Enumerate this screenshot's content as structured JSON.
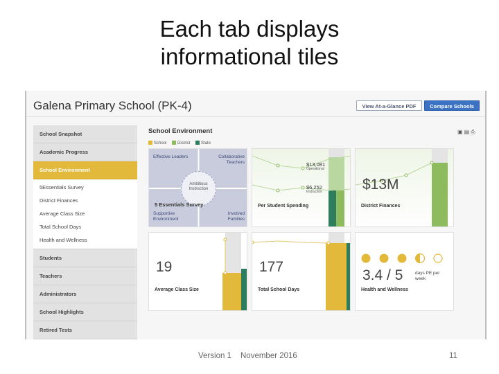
{
  "slide": {
    "title_line1": "Each tab displays",
    "title_line2": "informational tiles",
    "footer_version": "Version 1",
    "footer_date": "November 2016",
    "page_number": "11"
  },
  "header": {
    "school_name": "Galena Primary School (PK-4)",
    "at_a_glance_label": "View At-a-Glance PDF",
    "compare_label": "Compare Schools"
  },
  "sidebar": {
    "top_items": [
      {
        "label": "School Snapshot"
      },
      {
        "label": "Academic Progress"
      },
      {
        "label": "School Environment"
      }
    ],
    "sub_items": [
      {
        "label": "5Essentials Survey"
      },
      {
        "label": "District Finances"
      },
      {
        "label": "Average Class Size"
      },
      {
        "label": "Total School Days"
      },
      {
        "label": "Health and Wellness"
      }
    ],
    "bottom_items": [
      {
        "label": "Students"
      },
      {
        "label": "Teachers"
      },
      {
        "label": "Administrators"
      },
      {
        "label": "School Highlights"
      },
      {
        "label": "Retired Tests"
      }
    ]
  },
  "main": {
    "section_title": "School Environment",
    "legend": [
      {
        "label": "School",
        "color": "#e3b93c"
      },
      {
        "label": "District",
        "color": "#8dbb5e"
      },
      {
        "label": "State",
        "color": "#2e7d5f"
      }
    ],
    "tool_icons": [
      "pdf-icon",
      "document-icon",
      "print-icon"
    ],
    "essentials": {
      "effective_leaders": "Effective Leaders",
      "collaborative_teachers": "Collaborative Teachers",
      "ambitious_instruction": "Ambitious Instruction",
      "title": "5 Essentials Survey",
      "supportive_environment": "Supportive Environment",
      "involved_families": "Involved Families"
    },
    "spending": {
      "label": "Per Student Spending",
      "operational_value": "$13,081",
      "operational_label": "Operational",
      "instructional_value": "$6,252",
      "instructional_label": "Instruction"
    },
    "district_finances": {
      "value": "$13M",
      "label": "District Finances"
    },
    "class_size": {
      "value": "19",
      "label": "Average Class Size"
    },
    "school_days": {
      "value": "177",
      "label": "Total School Days"
    },
    "health": {
      "value": "3.4 / 5",
      "unit": "days PE per week",
      "label": "Health and Wellness",
      "dots_filled": 3.5,
      "dots_total": 5
    }
  },
  "colors": {
    "school": "#e3b93c",
    "district": "#8dbb5e",
    "state": "#2e7d5f",
    "compare_button": "#3b72c4"
  }
}
